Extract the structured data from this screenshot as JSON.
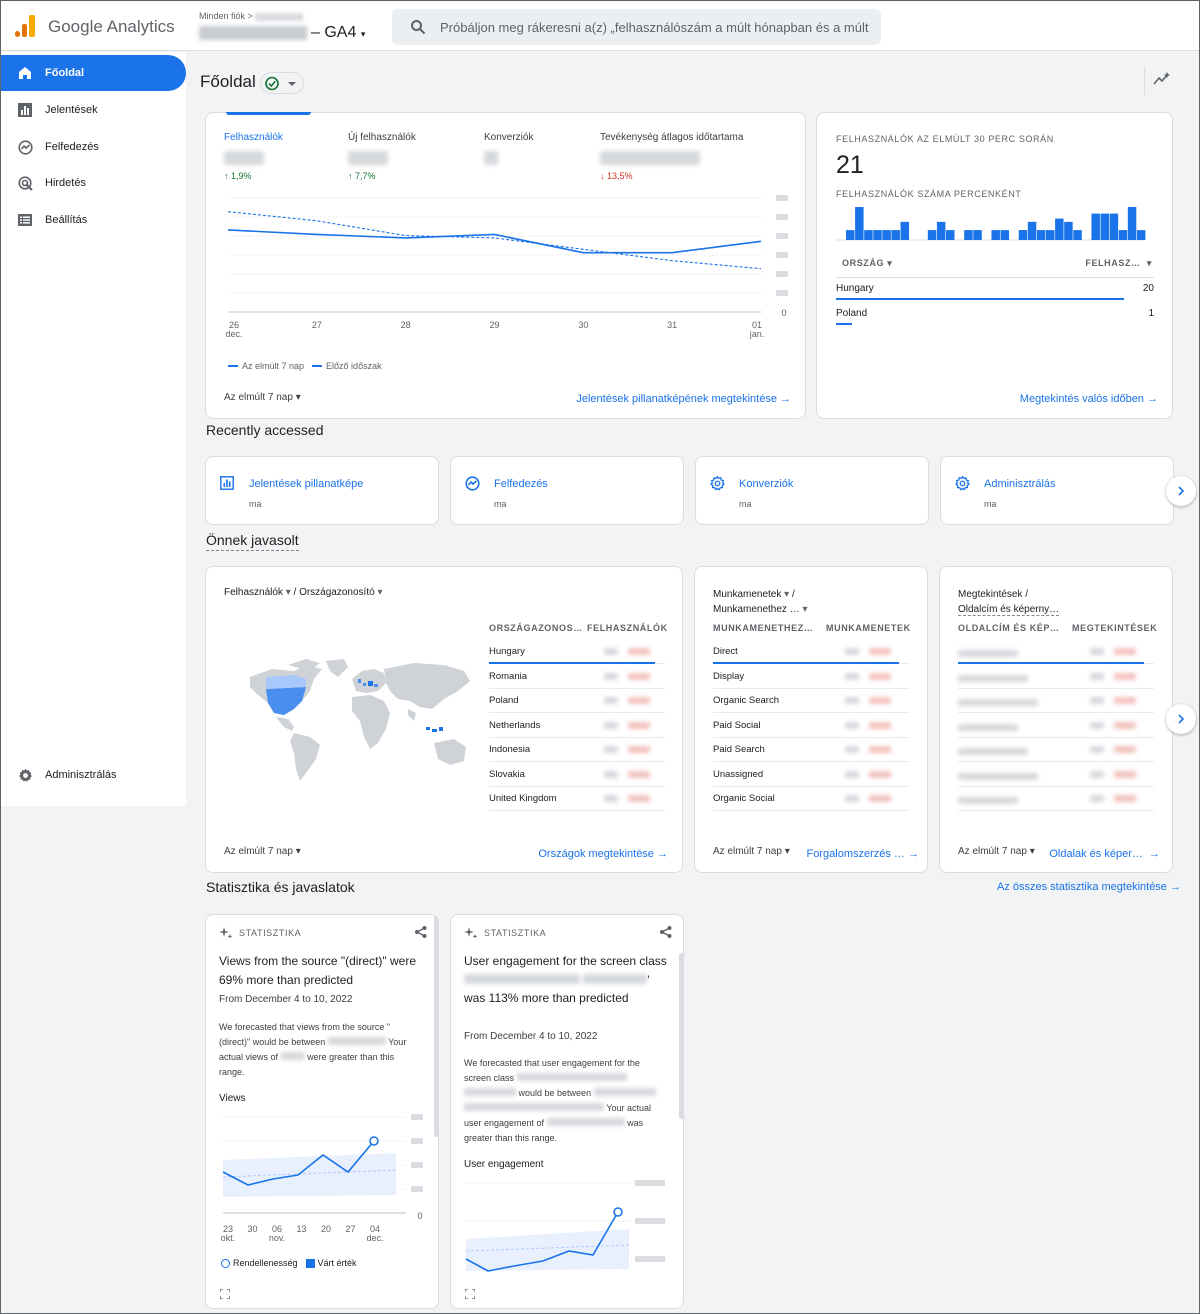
{
  "topbar": {
    "brand": "Google Analytics",
    "breadcrumb": "Minden fiók",
    "property_suffix": "– GA4",
    "search_placeholder": "Próbáljon meg rákeresni a(z) „felhasználószám a múlt hónapban és a múlt …"
  },
  "sidebar": {
    "items": [
      {
        "label": "Főoldal",
        "icon": "home-icon"
      },
      {
        "label": "Jelentések",
        "icon": "bar-chart-icon"
      },
      {
        "label": "Felfedezés",
        "icon": "explore-icon"
      },
      {
        "label": "Hirdetés",
        "icon": "ads-icon"
      },
      {
        "label": "Beállítás",
        "icon": "list-icon"
      }
    ],
    "admin_label": "Adminisztrálás"
  },
  "page": {
    "title": "Főoldal"
  },
  "overview": {
    "metrics": [
      {
        "label": "Felhasználók",
        "change": "1,9%",
        "direction": "up"
      },
      {
        "label": "Új felhasználók",
        "change": "7,7%",
        "direction": "up"
      },
      {
        "label": "Konverziók",
        "change": "",
        "direction": ""
      },
      {
        "label": "Tevékenység átlagos időtartama",
        "change": "13,5%",
        "direction": "down"
      }
    ],
    "y_ticks": [
      "0"
    ],
    "x_ticks": [
      {
        "day": "26",
        "month": "dec."
      },
      {
        "day": "27",
        "month": ""
      },
      {
        "day": "28",
        "month": ""
      },
      {
        "day": "29",
        "month": ""
      },
      {
        "day": "30",
        "month": ""
      },
      {
        "day": "31",
        "month": ""
      },
      {
        "day": "01",
        "month": "jan."
      }
    ],
    "legend_current": "Az elmúlt 7 nap",
    "legend_previous": "Előző időszak",
    "date_range": "Az elmúlt 7 nap",
    "link": "Jelentések pillanatképének megtekintése"
  },
  "chart_data": {
    "type": "line",
    "categories": [
      "26 dec.",
      "27",
      "28",
      "29",
      "30",
      "31",
      "01 jan."
    ],
    "series": [
      {
        "name": "Az elmúlt 7 nap",
        "values": [
          0.72,
          0.68,
          0.65,
          0.68,
          0.52,
          0.52,
          0.62
        ]
      },
      {
        "name": "Előző időszak",
        "values": [
          0.88,
          0.8,
          0.67,
          0.65,
          0.55,
          0.45,
          0.38
        ]
      }
    ],
    "xlabel": "",
    "ylabel": "",
    "ylim": [
      0,
      1
    ]
  },
  "realtime": {
    "title": "Felhasználók az elmúlt 30 perc során",
    "count": "21",
    "subtitle": "Felhasználók száma percenként",
    "bars": [
      0.3,
      1,
      0.3,
      0.3,
      0.3,
      0.3,
      0.55,
      0,
      0,
      0.3,
      0.55,
      0.3,
      0,
      0.3,
      0.3,
      0,
      0.3,
      0.3,
      0,
      0.3,
      0.55,
      0.3,
      0.3,
      0.65,
      0.55,
      0.3,
      0,
      0.8,
      0.8,
      0.8,
      0.3,
      1,
      0.3
    ],
    "col_country": "Ország",
    "col_users": "Felhasz…",
    "rows": [
      {
        "country": "Hungary",
        "value": "20",
        "share": 0.95
      },
      {
        "country": "Poland",
        "value": "1",
        "share": 0.05
      }
    ],
    "link": "Megtekintés valós időben"
  },
  "recent": {
    "title": "Recently accessed",
    "items": [
      {
        "label": "Jelentések pillanatképe",
        "sub": "ma",
        "icon": "bar-chart-icon"
      },
      {
        "label": "Felfedezés",
        "sub": "ma",
        "icon": "explore-icon"
      },
      {
        "label": "Konverziók",
        "sub": "ma",
        "icon": "gear-icon"
      },
      {
        "label": "Adminisztrálás",
        "sub": "ma",
        "icon": "gear-icon"
      }
    ]
  },
  "suggested": {
    "title": "Önnek javasolt",
    "countries": {
      "dim1": "Felhasználók",
      "dim2": "/ Országazonosító",
      "col1": "Országazonos…",
      "col2": "Felhasználók",
      "rows": [
        "Hungary",
        "Romania",
        "Poland",
        "Netherlands",
        "Indonesia",
        "Slovakia",
        "United Kingdom"
      ],
      "date_range": "Az elmúlt 7 nap",
      "link": "Országok megtekintése"
    },
    "sessions": {
      "dim1": "Munkamenetek",
      "dim2": "Munkamenethez …",
      "col1": "Munkamenethez…",
      "col2": "Munkamenetek",
      "rows": [
        "Direct",
        "Display",
        "Organic Search",
        "Paid Social",
        "Paid Search",
        "Unassigned",
        "Organic Social"
      ],
      "date_range": "Az elmúlt 7 nap",
      "link": "Forgalomszerzés …"
    },
    "pages": {
      "dim1": "Megtekintések /",
      "dim2": "Oldalcím és képerny…",
      "col1": "Oldalcím és kép…",
      "col2": "Megtekintések",
      "date_range": "Az elmúlt 7 nap",
      "link": "Oldalak és képer…"
    }
  },
  "insights": {
    "title": "Statisztika és javaslatok",
    "all_link": "Az összes statisztika megtekintése",
    "cards": [
      {
        "tag": "Statisztika",
        "headline": "Views from the source \"(direct)\" were 69% more than predicted",
        "date": "From December 4 to 10, 2022",
        "body1": "We forecasted that views from the source \"(direct)\" would be between",
        "body2": "Your actual views of",
        "body3": "were greater than this range.",
        "chart_label": "Views",
        "y_ticks": [
          "0"
        ],
        "x_ticks": [
          {
            "day": "23",
            "month": "okt."
          },
          {
            "day": "30",
            "month": ""
          },
          {
            "day": "06",
            "month": "nov."
          },
          {
            "day": "13",
            "month": ""
          },
          {
            "day": "20",
            "month": ""
          },
          {
            "day": "27",
            "month": ""
          },
          {
            "day": "04",
            "month": "dec."
          }
        ],
        "legend_anomaly": "Rendellenesség",
        "legend_expected": "Várt érték"
      },
      {
        "tag": "Statisztika",
        "headline_start": "User engagement for the screen class",
        "headline_end": "' was 113% more than predicted",
        "date": "From December 4 to 10, 2022",
        "body1": "We forecasted that user engagement for the screen class",
        "body2": "would be between",
        "body3": "Your actual user engagement of",
        "body4": "was greater than this range.",
        "chart_label": "User engagement"
      }
    ]
  },
  "colors": {
    "accent": "#1a73e8",
    "positive": "#137333",
    "negative": "#d93025",
    "orange": "#f9ab00"
  }
}
